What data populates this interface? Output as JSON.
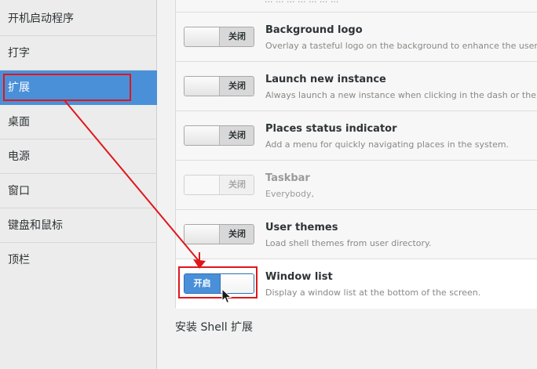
{
  "sidebar": {
    "items": [
      {
        "label": "开机启动程序"
      },
      {
        "label": "打字"
      },
      {
        "label": "扩展"
      },
      {
        "label": "桌面"
      },
      {
        "label": "电源"
      },
      {
        "label": "窗口"
      },
      {
        "label": "键盘和鼠标"
      },
      {
        "label": "顶栏"
      }
    ],
    "selected": "扩展"
  },
  "extensions": {
    "top_partial_desc": "... ... ... ... ... ... ...",
    "rows": [
      {
        "title": "Background logo",
        "description": "Overlay a tasteful logo on the background to enhance the user e",
        "switch_label": "关闭",
        "state": "off",
        "enabled": true
      },
      {
        "title": "Launch new instance",
        "description": "Always launch a new instance when clicking in the dash or the a",
        "switch_label": "关闭",
        "state": "off",
        "enabled": true
      },
      {
        "title": "Places status indicator",
        "description": "Add a menu for quickly navigating places in the system.",
        "switch_label": "关闭",
        "state": "off",
        "enabled": true
      },
      {
        "title": "Taskbar",
        "description": "Everybody,",
        "switch_label": "关闭",
        "state": "off",
        "enabled": false
      },
      {
        "title": "User themes",
        "description": "Load shell themes from user directory.",
        "switch_label": "关闭",
        "state": "off",
        "enabled": true
      },
      {
        "title": "Window list",
        "description": "Display a window list at the bottom of the screen.",
        "switch_label": "开启",
        "state": "on",
        "enabled": true
      }
    ],
    "install_label": "安装 Shell 扩展"
  },
  "colors": {
    "accent": "#4a90d9",
    "annotation": "#e0161b"
  },
  "icons": {
    "cursor": "mouse-pointer-icon"
  }
}
